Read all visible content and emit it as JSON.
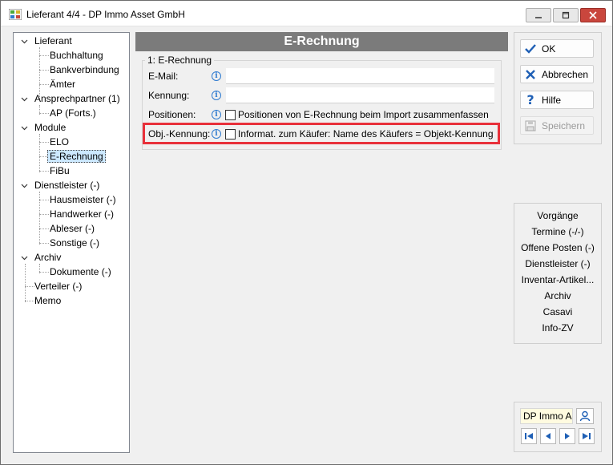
{
  "window": {
    "title": "Lieferant 4/4 - DP Immo Asset GmbH"
  },
  "tree": [
    {
      "label": "Lieferant"
    },
    {
      "label": "Buchhaltung"
    },
    {
      "label": "Bankverbindung"
    },
    {
      "label": "Ämter"
    },
    {
      "label": "Ansprechpartner (1)"
    },
    {
      "label": "AP (Forts.)"
    },
    {
      "label": "Module"
    },
    {
      "label": "ELO"
    },
    {
      "label": "E-Rechnung"
    },
    {
      "label": "FiBu"
    },
    {
      "label": "Dienstleister (-)"
    },
    {
      "label": "Hausmeister (-)"
    },
    {
      "label": "Handwerker (-)"
    },
    {
      "label": "Ableser (-)"
    },
    {
      "label": "Sonstige (-)"
    },
    {
      "label": "Archiv"
    },
    {
      "label": "Dokumente (-)"
    },
    {
      "label": "Verteiler (-)"
    },
    {
      "label": "Memo"
    }
  ],
  "panel": {
    "header": "E-Rechnung",
    "group_title": "1: E-Rechnung",
    "email_label": "E-Mail:",
    "email_value": "",
    "kennung_label": "Kennung:",
    "kennung_value": "",
    "positionen_label": "Positionen:",
    "positionen_checkbox": "Positionen von E-Rechnung beim Import zusammenfassen",
    "objkennung_label": "Obj.-Kennung:",
    "objkennung_checkbox": "Informat. zum Käufer: Name des Käufers = Objekt-Kennung",
    "info_glyph": "i"
  },
  "buttons": {
    "ok": "OK",
    "abbrechen": "Abbrechen",
    "hilfe": "Hilfe",
    "speichern": "Speichern"
  },
  "nav_links": [
    "Vorgänge",
    "Termine (-/-)",
    "Offene Posten (-)",
    "Dienstleister (-)",
    "Inventar-Artikel...",
    "Archiv",
    "Casavi",
    "Info-ZV"
  ],
  "record": {
    "selector": "DP Immo A"
  },
  "colors": {
    "header_bg": "#7b7b7b",
    "highlight": "#e8303a",
    "accent_blue": "#1e5fb5",
    "close_button": "#c9463d"
  }
}
